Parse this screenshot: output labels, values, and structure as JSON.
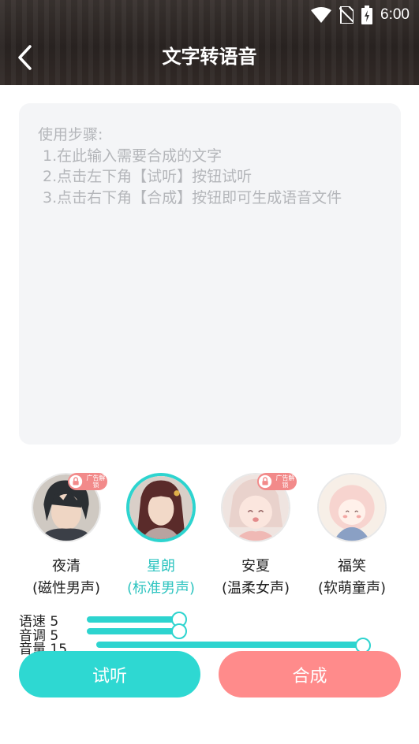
{
  "status_bar": {
    "time": "6:00",
    "icons": [
      "wifi-icon",
      "no-sim-icon",
      "battery-charging-icon"
    ]
  },
  "header": {
    "title": "文字转语音",
    "back_icon": "chevron-left-icon"
  },
  "editor": {
    "placeholder": "使用步骤:\n 1.在此输入需要合成的文字\n 2.点击左下角【试听】按钮试听\n 3.点击右下角【合成】按钮即可生成语音文件"
  },
  "voices": [
    {
      "name": "夜清",
      "desc": "(磁性男声)",
      "locked": true,
      "lock_label": "广告解锁"
    },
    {
      "name": "星朗",
      "desc": "(标准男声)",
      "selected": true
    },
    {
      "name": "安夏",
      "desc": "(温柔女声)",
      "locked": true,
      "lock_label": "广告解锁"
    },
    {
      "name": "福笑",
      "desc": "(软萌童声)"
    }
  ],
  "sliders": [
    {
      "label": "语速 5",
      "value": 5
    },
    {
      "label": "音调 5",
      "value": 5
    },
    {
      "label": "音量 15",
      "value": 15
    }
  ],
  "buttons": {
    "listen": "试听",
    "synthesize": "合成"
  },
  "colors": {
    "accent": "#2dd4cf",
    "synth": "#ff8b8b",
    "lock_badge": "#f28a8a"
  }
}
